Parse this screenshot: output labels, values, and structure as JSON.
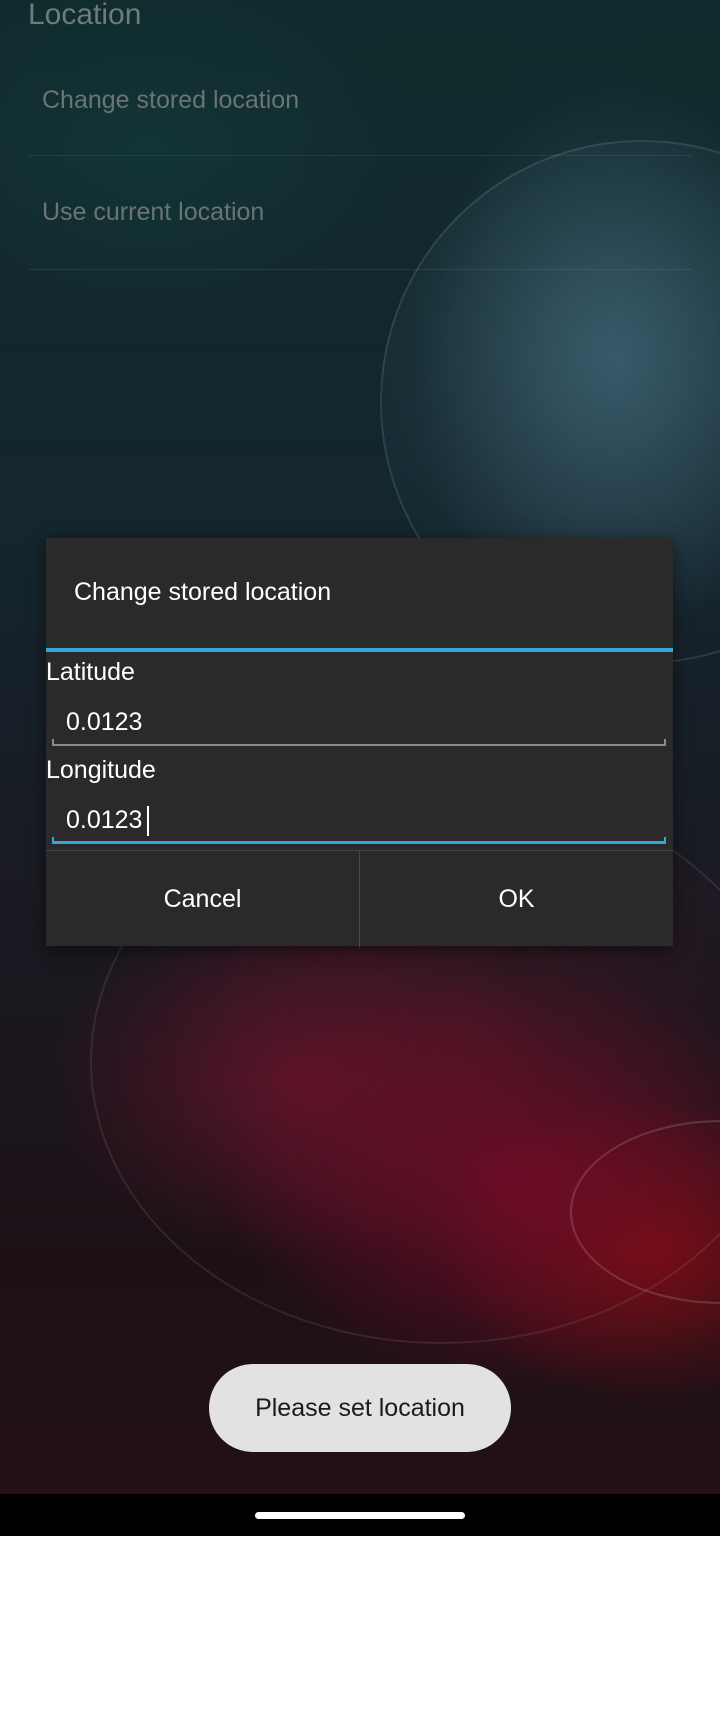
{
  "settings": {
    "section_title": "Location",
    "items": [
      {
        "label": "Change stored location"
      },
      {
        "label": "Use current location"
      }
    ]
  },
  "dialog": {
    "title": "Change stored location",
    "latitude": {
      "label": "Latitude",
      "value": "0.0123"
    },
    "longitude": {
      "label": "Longitude",
      "value": "0.0123"
    },
    "cancel_label": "Cancel",
    "ok_label": "OK"
  },
  "toast": {
    "message": "Please set location"
  },
  "colors": {
    "accent": "#33a7d9",
    "dialog_bg": "#2a2a2a",
    "toast_bg": "#e2e1e3"
  }
}
